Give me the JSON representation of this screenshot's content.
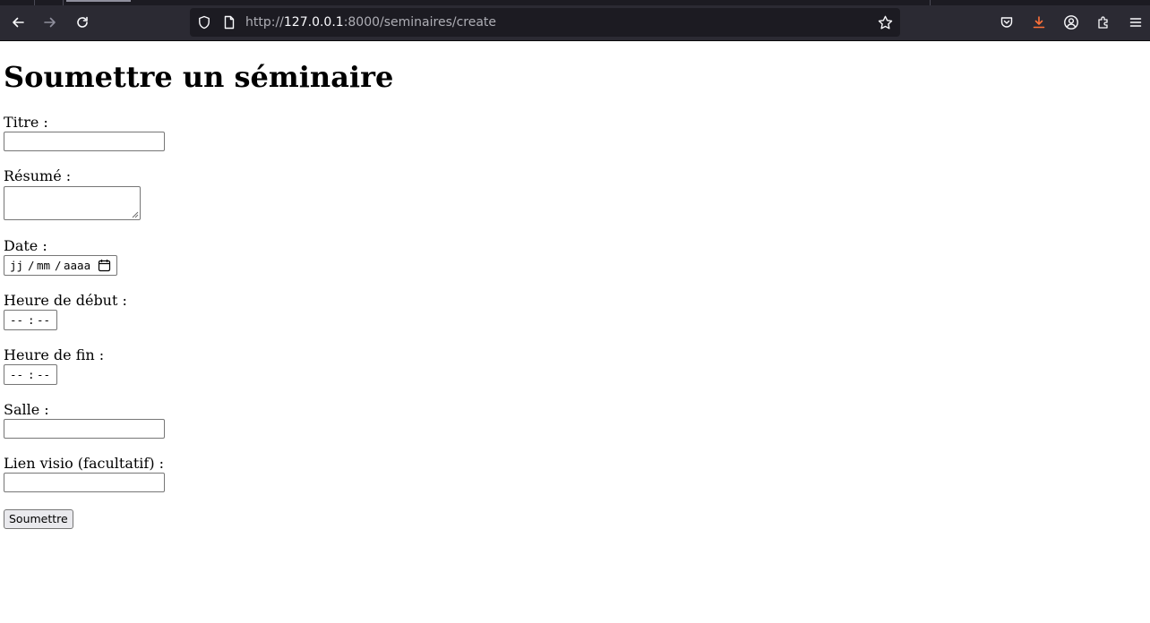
{
  "browser": {
    "url_prefix": "http://",
    "url_host": "127.0.0.1",
    "url_path": ":8000/seminaires/create",
    "downloads_accent": "#ff7139"
  },
  "icons": {
    "back": "back-arrow-icon",
    "forward": "forward-arrow-icon",
    "reload": "reload-icon",
    "shield": "tracking-protection-shield-icon",
    "page": "page-icon",
    "bookmark": "bookmark-star-icon",
    "pocket": "pocket-icon",
    "downloads": "downloads-icon",
    "account": "account-icon",
    "extensions": "extensions-icon",
    "menu": "hamburger-menu-icon",
    "calendar": "calendar-icon"
  },
  "page": {
    "title": "Soumettre un séminaire"
  },
  "form": {
    "titre_label": "Titre :",
    "titre_value": "",
    "resume_label": "Résumé :",
    "resume_value": "",
    "date_label": "Date :",
    "date_day": "jj",
    "date_sep1": "/",
    "date_month": "mm",
    "date_sep2": "/",
    "date_year": "aaaa",
    "heure_debut_label": "Heure de début :",
    "heure_debut_hours": "--",
    "heure_debut_sep": ":",
    "heure_debut_minutes": "--",
    "heure_fin_label": "Heure de fin :",
    "heure_fin_hours": "--",
    "heure_fin_sep": ":",
    "heure_fin_minutes": "--",
    "salle_label": "Salle :",
    "salle_value": "",
    "lien_label": "Lien visio (facultatif) :",
    "lien_value": "",
    "submit_label": "Soumettre"
  }
}
